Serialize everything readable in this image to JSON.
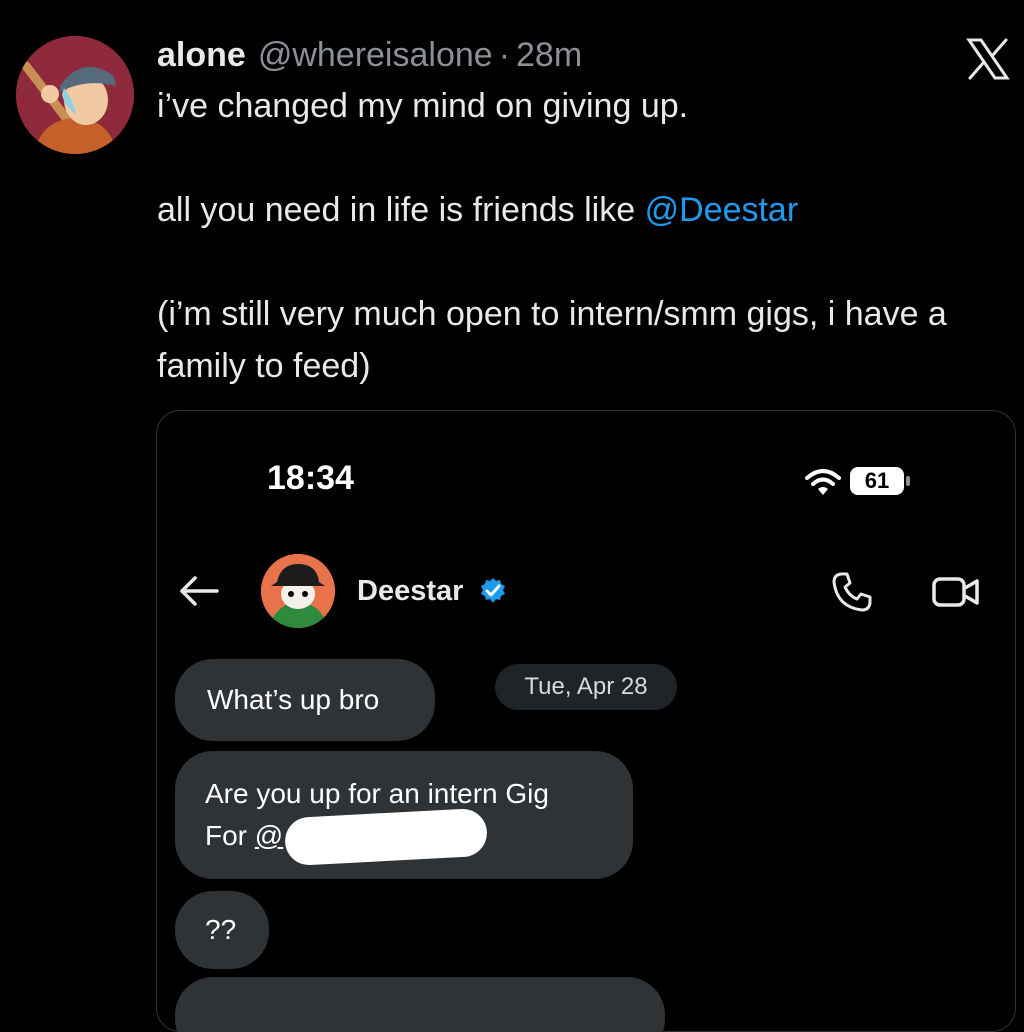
{
  "tweet": {
    "author_name": "alone",
    "author_handle": "@whereisalone",
    "separator": "·",
    "time_ago": "28m",
    "text_line1": "i’ve changed my mind on giving up.",
    "text_line2_prefix": "all you need in life is friends like ",
    "text_line2_mention": "@Deestar",
    "text_line3": "(i’m still very much open to intern/smm gigs, i have a family to feed)",
    "close_icon": "x-logo-icon"
  },
  "screenshot": {
    "status_time": "18:34",
    "battery_level": "61",
    "contact_name": "Deestar",
    "date_separator": "Tue, Apr 28",
    "messages": [
      {
        "text": "What’s up bro"
      },
      {
        "line1": "Are you up for an intern Gig",
        "line2_prefix": "For ",
        "line2_link": "@"
      },
      {
        "text": "??"
      }
    ]
  },
  "colors": {
    "background": "#000000",
    "mention": "#1d9bf0",
    "bubble": "#2f3336",
    "verified": "#1d9bf0"
  }
}
